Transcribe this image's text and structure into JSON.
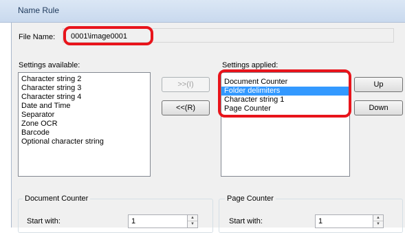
{
  "window": {
    "title": "Name Rule"
  },
  "file_name": {
    "label": "File Name:",
    "value": "0001\\image0001"
  },
  "available": {
    "label": "Settings available:",
    "items": [
      "Character string 2",
      "Character string 3",
      "Character string 4",
      "Date and Time",
      "Separator",
      "Zone OCR",
      "Barcode",
      "Optional character string"
    ]
  },
  "move_buttons": {
    "add": ">>(I)",
    "remove": "<<(R)"
  },
  "applied": {
    "label": "Settings applied:",
    "items": [
      "Document Counter",
      "Folder delimiters",
      "Character string 1",
      "Page Counter"
    ],
    "selected_index": 1
  },
  "order_buttons": {
    "up": "Up",
    "down": "Down"
  },
  "document_counter": {
    "title": "Document Counter",
    "start_label": "Start with:",
    "start_value": "1"
  },
  "page_counter": {
    "title": "Page Counter",
    "start_label": "Start with:",
    "start_value": "1"
  },
  "colors": {
    "highlight": "#e8141b",
    "selection": "#3399ff",
    "dialog_bg": "#f0f0f0"
  }
}
